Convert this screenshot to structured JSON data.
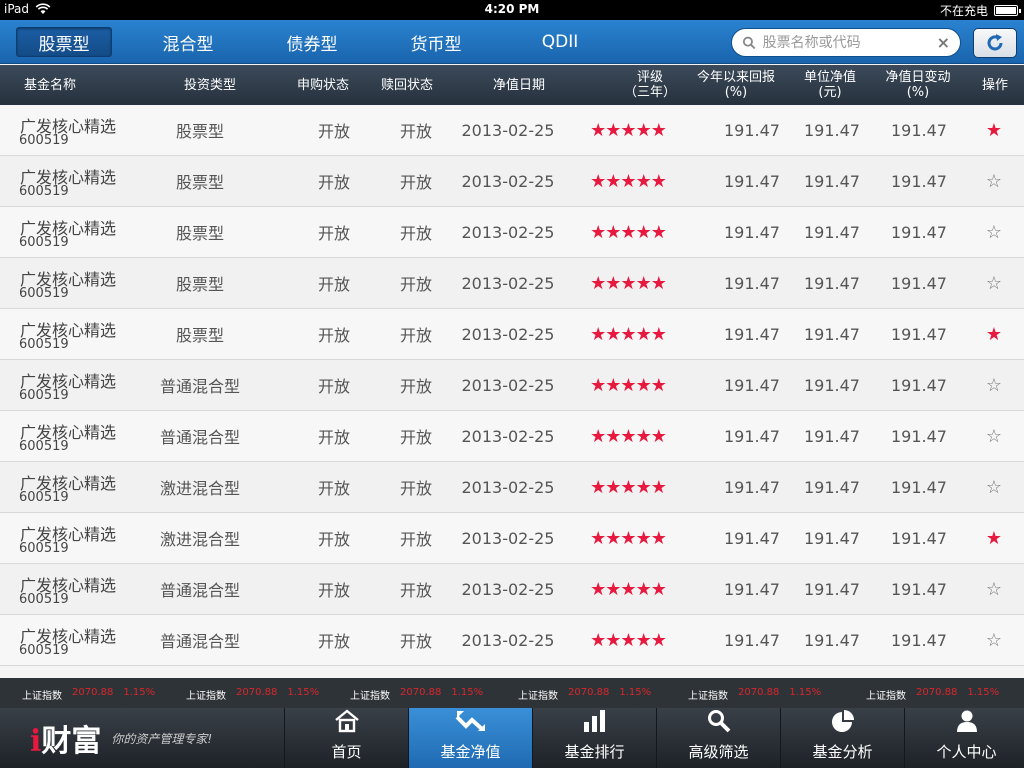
{
  "status": {
    "device": "iPad",
    "time": "4:20 PM",
    "charging": "不在充电"
  },
  "tabs": [
    {
      "label": "股票型",
      "active": true
    },
    {
      "label": "混合型",
      "active": false
    },
    {
      "label": "债券型",
      "active": false
    },
    {
      "label": "货币型",
      "active": false
    },
    {
      "label": "QDII",
      "active": false
    }
  ],
  "search": {
    "placeholder": "股票名称或代码"
  },
  "columns": {
    "name": "基金名称",
    "type": "投资类型",
    "purchase": "申购状态",
    "redeem": "赎回状态",
    "date": "净值日期",
    "rating": "评级\n（三年）",
    "ytd": "今年以来回报\n(%)",
    "nav": "单位净值\n(元)",
    "change": "净值日变动\n(%)",
    "action": "操作"
  },
  "rows": [
    {
      "name": "广发核心精选",
      "code": "600519",
      "type": "股票型",
      "purchase": "开放",
      "redeem": "开放",
      "date": "2013-02-25",
      "stars": "★★★★★",
      "ytd": "191.47",
      "nav": "191.47",
      "change": "191.47",
      "fav": true
    },
    {
      "name": "广发核心精选",
      "code": "600519",
      "type": "股票型",
      "purchase": "开放",
      "redeem": "开放",
      "date": "2013-02-25",
      "stars": "★★★★★",
      "ytd": "191.47",
      "nav": "191.47",
      "change": "191.47",
      "fav": false
    },
    {
      "name": "广发核心精选",
      "code": "600519",
      "type": "股票型",
      "purchase": "开放",
      "redeem": "开放",
      "date": "2013-02-25",
      "stars": "★★★★★",
      "ytd": "191.47",
      "nav": "191.47",
      "change": "191.47",
      "fav": false
    },
    {
      "name": "广发核心精选",
      "code": "600519",
      "type": "股票型",
      "purchase": "开放",
      "redeem": "开放",
      "date": "2013-02-25",
      "stars": "★★★★★",
      "ytd": "191.47",
      "nav": "191.47",
      "change": "191.47",
      "fav": false
    },
    {
      "name": "广发核心精选",
      "code": "600519",
      "type": "股票型",
      "purchase": "开放",
      "redeem": "开放",
      "date": "2013-02-25",
      "stars": "★★★★★",
      "ytd": "191.47",
      "nav": "191.47",
      "change": "191.47",
      "fav": true
    },
    {
      "name": "广发核心精选",
      "code": "600519",
      "type": "普通混合型",
      "purchase": "开放",
      "redeem": "开放",
      "date": "2013-02-25",
      "stars": "★★★★★",
      "ytd": "191.47",
      "nav": "191.47",
      "change": "191.47",
      "fav": false
    },
    {
      "name": "广发核心精选",
      "code": "600519",
      "type": "普通混合型",
      "purchase": "开放",
      "redeem": "开放",
      "date": "2013-02-25",
      "stars": "★★★★★",
      "ytd": "191.47",
      "nav": "191.47",
      "change": "191.47",
      "fav": false
    },
    {
      "name": "广发核心精选",
      "code": "600519",
      "type": "激进混合型",
      "purchase": "开放",
      "redeem": "开放",
      "date": "2013-02-25",
      "stars": "★★★★★",
      "ytd": "191.47",
      "nav": "191.47",
      "change": "191.47",
      "fav": false
    },
    {
      "name": "广发核心精选",
      "code": "600519",
      "type": "激进混合型",
      "purchase": "开放",
      "redeem": "开放",
      "date": "2013-02-25",
      "stars": "★★★★★",
      "ytd": "191.47",
      "nav": "191.47",
      "change": "191.47",
      "fav": true
    },
    {
      "name": "广发核心精选",
      "code": "600519",
      "type": "普通混合型",
      "purchase": "开放",
      "redeem": "开放",
      "date": "2013-02-25",
      "stars": "★★★★★",
      "ytd": "191.47",
      "nav": "191.47",
      "change": "191.47",
      "fav": false
    },
    {
      "name": "广发核心精选",
      "code": "600519",
      "type": "普通混合型",
      "purchase": "开放",
      "redeem": "开放",
      "date": "2013-02-25",
      "stars": "★★★★★",
      "ytd": "191.47",
      "nav": "191.47",
      "change": "191.47",
      "fav": false
    }
  ],
  "ticker": [
    {
      "label": "上证指数",
      "value": "2070.88",
      "pct": "1.15%"
    },
    {
      "label": "上证指数",
      "value": "2070.88",
      "pct": "1.15%"
    },
    {
      "label": "上证指数",
      "value": "2070.88",
      "pct": "1.15%"
    },
    {
      "label": "上证指数",
      "value": "2070.88",
      "pct": "1.15%"
    },
    {
      "label": "上证指数",
      "value": "2070.88",
      "pct": "1.15%"
    },
    {
      "label": "上证指数",
      "value": "2070.88",
      "pct": "1.15%"
    }
  ],
  "brand": {
    "logo_i": "i",
    "logo_text": "财富",
    "slogan": "你的资产管理专家!"
  },
  "nav": [
    {
      "label": "首页",
      "icon": "home-icon",
      "active": false
    },
    {
      "label": "基金净值",
      "icon": "trend-icon",
      "active": true
    },
    {
      "label": "基金排行",
      "icon": "bar-chart-icon",
      "active": false
    },
    {
      "label": "高级筛选",
      "icon": "search-icon",
      "active": false
    },
    {
      "label": "基金分析",
      "icon": "pie-chart-icon",
      "active": false
    },
    {
      "label": "个人中心",
      "icon": "user-icon",
      "active": false
    }
  ],
  "colors": {
    "accent": "#1f6ab2",
    "star": "#e8193f",
    "ticker_value": "#d8262b"
  }
}
